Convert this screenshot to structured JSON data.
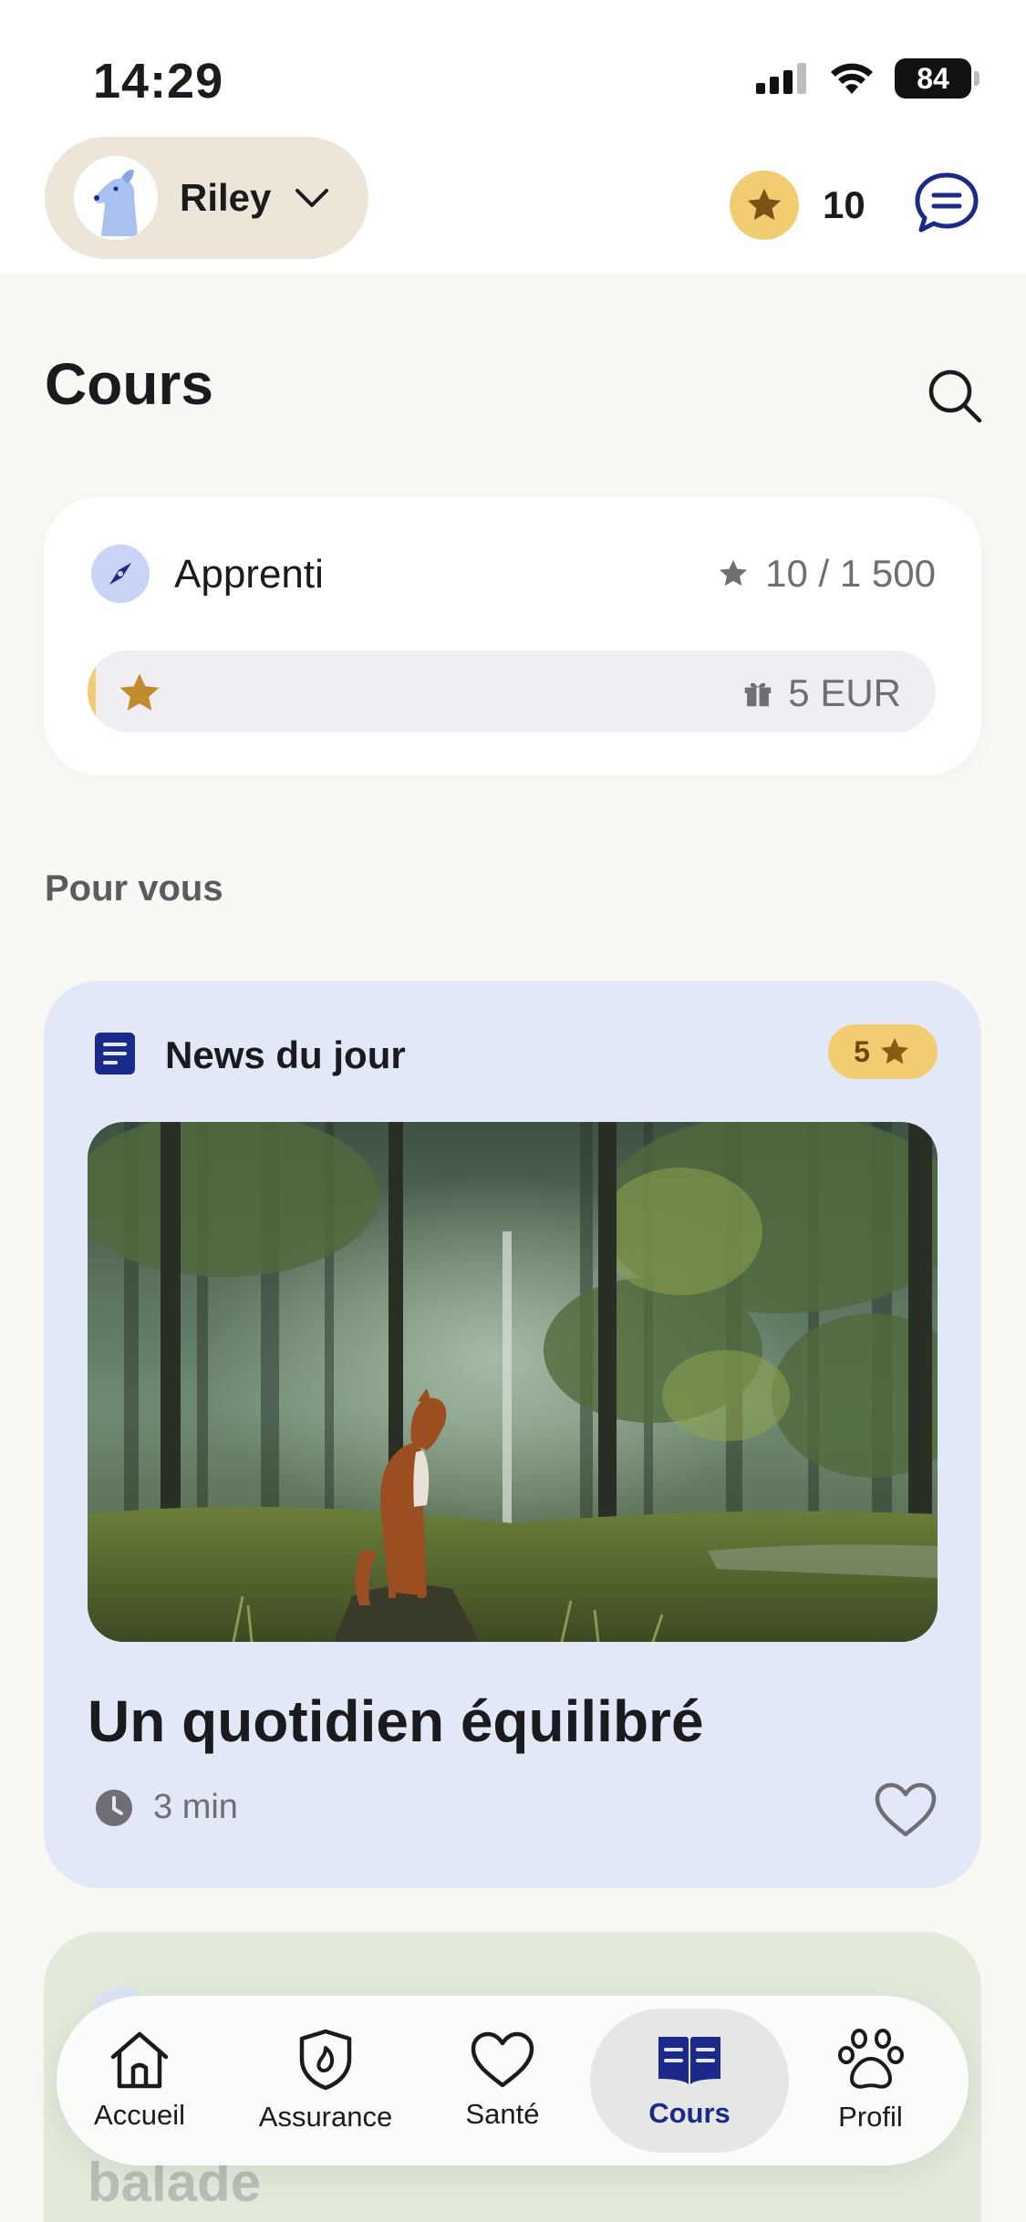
{
  "status_bar": {
    "time": "14:29",
    "battery": "84"
  },
  "header": {
    "pet_name": "Riley",
    "points": "10"
  },
  "page": {
    "title": "Cours"
  },
  "level": {
    "name": "Apprenti",
    "points_progress": "10 / 1 500",
    "progress_fraction": 0.0067,
    "reward": "5 EUR"
  },
  "section": {
    "title": "Pour vous"
  },
  "article": {
    "type_label": "News du jour",
    "reward_points": "5",
    "title": "Un quotidien équilibré",
    "duration": "3 min"
  },
  "article2": {
    "title": "balade"
  },
  "tabs": [
    {
      "label": "Accueil",
      "icon": "home-icon",
      "active": false
    },
    {
      "label": "Assurance",
      "icon": "shield-icon",
      "active": false
    },
    {
      "label": "Santé",
      "icon": "heart-icon",
      "active": false
    },
    {
      "label": "Cours",
      "icon": "book-icon",
      "active": true
    },
    {
      "label": "Profil",
      "icon": "paw-icon",
      "active": false
    }
  ],
  "colors": {
    "accent": "#1b2a8a",
    "gold": "#f2cc71",
    "background": "#faf8f5",
    "article_card": "#e2e8f8"
  }
}
